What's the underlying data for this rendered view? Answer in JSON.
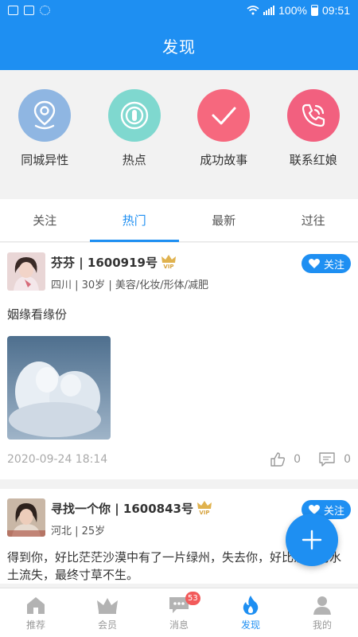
{
  "status_bar": {
    "battery": "100%",
    "time": "09:51"
  },
  "header": {
    "title": "发现"
  },
  "quick_actions": [
    {
      "label": "同城异性",
      "icon": "location-pin-icon",
      "color": "#8fb6e2"
    },
    {
      "label": "热点",
      "icon": "broadcast-icon",
      "color": "#7fd8cf"
    },
    {
      "label": "成功故事",
      "icon": "checkmark-icon",
      "color": "#f6687e"
    },
    {
      "label": "联系红娘",
      "icon": "phone-icon",
      "color": "#f2607f"
    }
  ],
  "tabs": [
    {
      "label": "关注"
    },
    {
      "label": "热门"
    },
    {
      "label": "最新"
    },
    {
      "label": "过往"
    }
  ],
  "posts": [
    {
      "name": "芬芬 | 1600919号",
      "vip": "VIP",
      "info": "四川 | 30岁 | 美容/化妆/形体/减肥",
      "follow": "关注",
      "text": "姻缘看缘份",
      "time": "2020-09-24 18:14",
      "likes": "0",
      "comments": "0"
    },
    {
      "name": "寻找一个你 | 1600843号",
      "vip": "VIP",
      "info": "河北 | 25岁",
      "follow": "关注",
      "text": "得到你，好比茫茫沙漠中有了一片绿州，失去你，好比沙漠的水土流失，最终寸草不生。"
    }
  ],
  "bottom_nav": [
    {
      "label": "推荐"
    },
    {
      "label": "会员"
    },
    {
      "label": "消息",
      "badge": "53"
    },
    {
      "label": "发现"
    },
    {
      "label": "我的"
    }
  ],
  "colors": {
    "primary": "#1e8ff2",
    "badge": "#f25a5a"
  }
}
